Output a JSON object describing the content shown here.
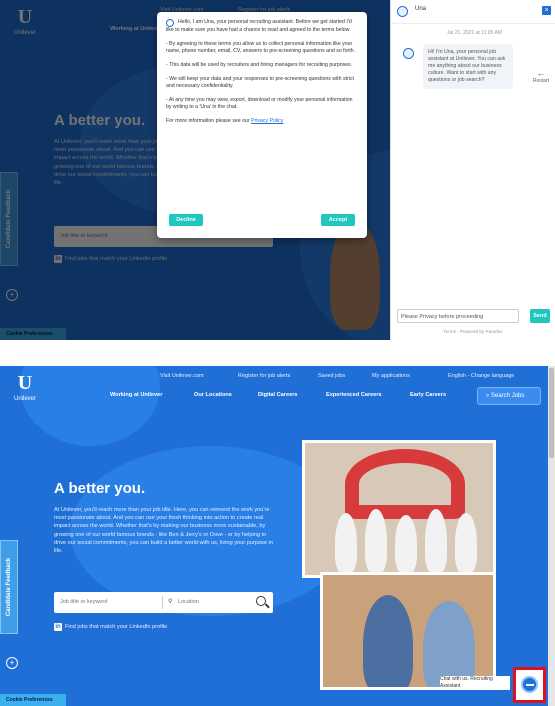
{
  "site": {
    "logo_text": "Unilever",
    "logo_glyph": "U"
  },
  "util_links": [
    "Visit Unilever.com",
    "Register for job alerts",
    "Saved jobs",
    "My applications",
    "English - Change language"
  ],
  "nav_items": [
    "Working at Unilever",
    "Our Locations",
    "Digital Careers",
    "Experienced Careers",
    "Early Careers"
  ],
  "search_jobs_label": "Search Jobs",
  "hero": {
    "title": "A better you.",
    "copy": "At Unilever, you'll reach more than your job title. Here, you can reinvent the work you're most passionate about. And you can use your fresh thinking into action to create real impact across the world. Whether that's by making our business more sustainable, by growing one of our world famous brands - like Ben & Jerry's or Dove - or by helping to drive our social commitments, you can build a better world with us, living your purpose in life."
  },
  "job_search": {
    "keyword_placeholder": "Job title or keyword",
    "location_placeholder": "Location"
  },
  "profile_line": "Find jobs that match your LinkedIn profile",
  "feedback_label": "Candidate Feedback",
  "preferences_label": "Cookie Preferences",
  "modal": {
    "intro": "Hello, I am Una, your personal recruiting assistant. Before we get started I'd like to make sure you have had a chance to read and agreed to the terms below.",
    "p1": "- By agreeing to these terms you allow us to collect personal information like your name, phone number, email, CV, answers to pre-screening questions and so forth.",
    "p2": "- This data will be used by recruiters and hiring managers for recruiting purposes.",
    "p3": "- We will keep your data and your responses to pre-screening questions with strict and necessary confidentiality.",
    "p4": "- At any time you may view, export, download or modify your personal information by writing to a 'Una' in the chat.",
    "p5_pre": "For more information please see our ",
    "p5_link": "Privacy Policy",
    "decline": "Decline",
    "accept": "Accept"
  },
  "chat": {
    "title": "Una",
    "timestamp": "Jul 21, 2022 at 11:05 AM",
    "bubble": "Hi! I'm Una, your personal job assistant at Unilever. You can ask me anything about our business culture. Want to start with any questions or job search?",
    "restart_label": "Restart",
    "input_placeholder": "Please Privacy before proceeding",
    "send_label": "Send",
    "footer": "Terms · Powered by Paradox"
  },
  "launcher_tip": "Chat with us. Recruiting Assistant",
  "colors": {
    "brand_blue": "#1f6fd6",
    "accent_teal": "#20c6c0",
    "highlight_red": "#e01020"
  }
}
